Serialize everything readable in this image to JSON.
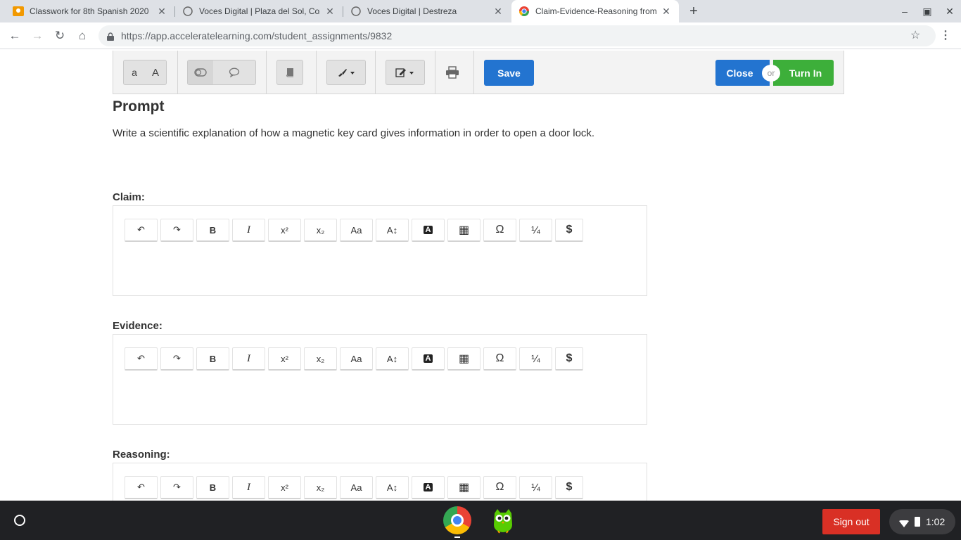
{
  "browser": {
    "tabs": [
      {
        "title": "Classwork for 8th Spanish 2020"
      },
      {
        "title": "Voces Digital | Plaza del Sol, Coz"
      },
      {
        "title": "Voces Digital | Destreza"
      },
      {
        "title": "Claim-Evidence-Reasoning from"
      }
    ],
    "url": "https://app.acceleratelearning.com/student_assignments/9832"
  },
  "app_toolbar": {
    "font_small": "a",
    "font_large": "A",
    "save_label": "Save",
    "close_label": "Close",
    "or_label": "or",
    "turnin_label": "Turn In"
  },
  "content": {
    "prompt_title": "Prompt",
    "prompt_text": "Write a scientific explanation of how a magnetic key card gives information in order to open a door lock.",
    "sections": [
      {
        "label": "Claim:"
      },
      {
        "label": "Evidence:"
      },
      {
        "label": "Reasoning:"
      }
    ]
  },
  "editor_toolbar": {
    "undo": "↶",
    "redo": "↷",
    "bold": "B",
    "italic": "I",
    "superscript": "x²",
    "subscript": "x₂",
    "font": "Aa",
    "size": "A↕",
    "highlight": "A",
    "table": "▦",
    "omega": "Ω",
    "fraction": "¼",
    "dollar": "$"
  },
  "shelf": {
    "signout_label": "Sign out",
    "time": "1:02"
  },
  "colors": {
    "save_blue": "#2374d0",
    "turnin_green": "#3daf3a",
    "signout_red": "#d93025"
  }
}
